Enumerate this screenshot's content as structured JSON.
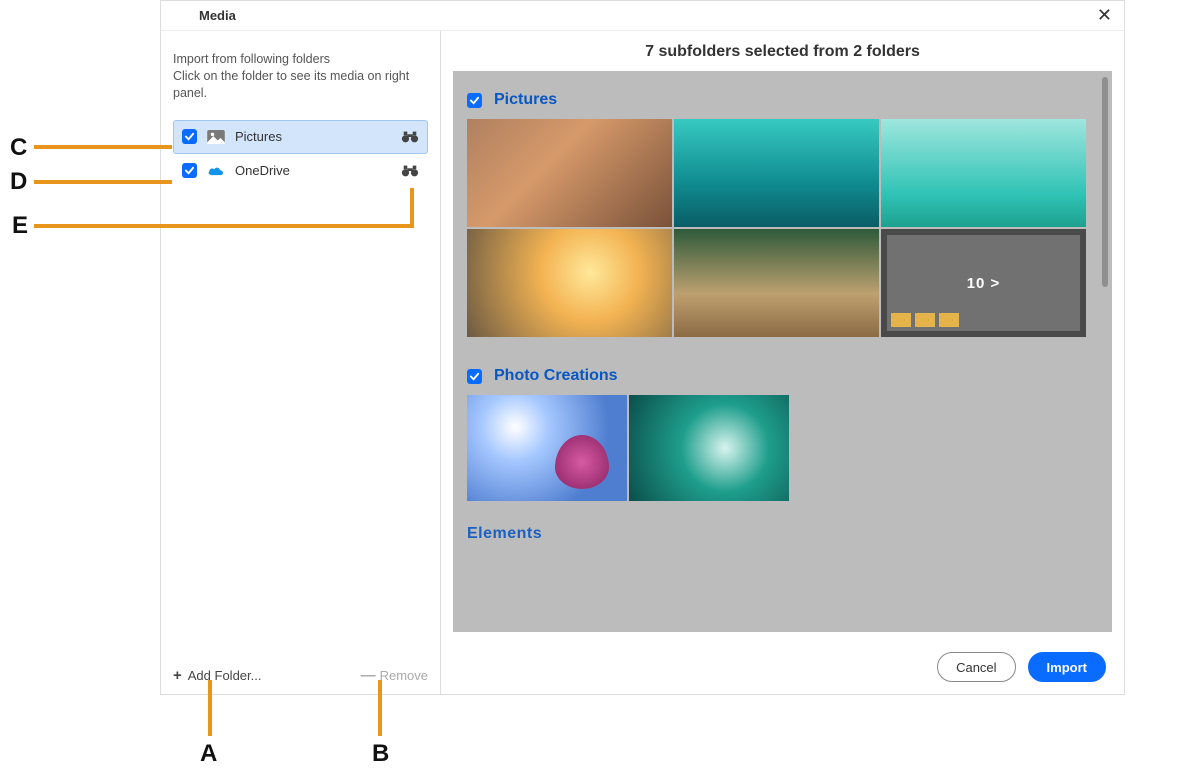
{
  "dialog": {
    "title": "Media",
    "close_glyph": "✕"
  },
  "leftPane": {
    "instructions": "Import from following folders\nClick on the folder to see its media on right panel.",
    "folders": [
      {
        "label": "Pictures",
        "checked": true,
        "selected": true,
        "icon": "pictures"
      },
      {
        "label": "OneDrive",
        "checked": true,
        "selected": false,
        "icon": "onedrive"
      }
    ],
    "addFolderLabel": "Add Folder...",
    "removeLabel": "Remove"
  },
  "rightPane": {
    "summary": "7 subfolders selected from 2 folders",
    "sections": [
      {
        "title": "Pictures",
        "checked": true,
        "more_count": "10",
        "more_arrow": ">"
      },
      {
        "title": "Photo Creations",
        "checked": true
      }
    ],
    "peek_title": "Elements"
  },
  "footer": {
    "cancel": "Cancel",
    "import": "Import"
  },
  "callouts": {
    "A": "A",
    "B": "B",
    "C": "C",
    "D": "D",
    "E": "E"
  }
}
